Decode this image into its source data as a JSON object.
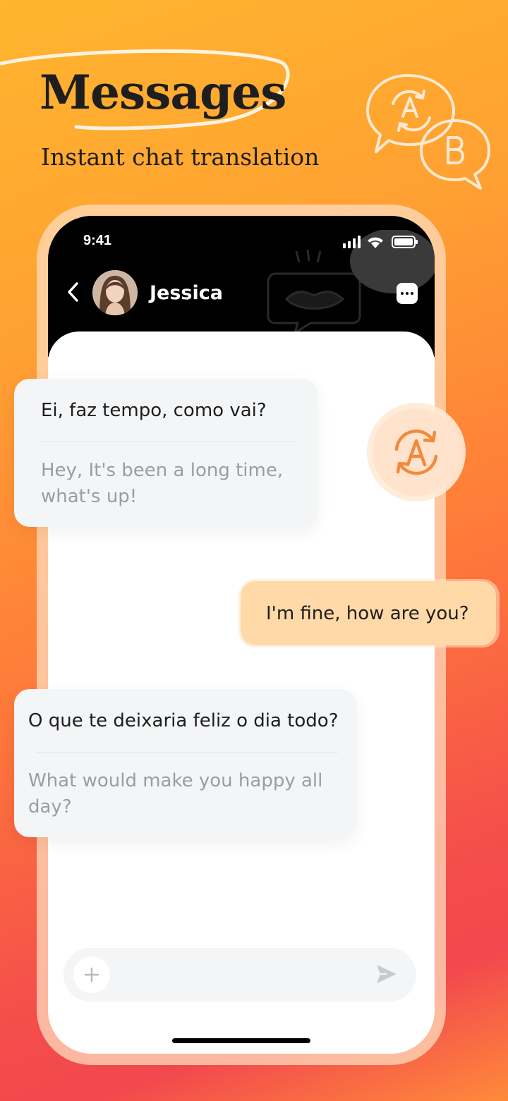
{
  "promo": {
    "headline": "Messages",
    "subheadline": "Instant chat translation"
  },
  "status_bar": {
    "time": "9:41"
  },
  "chat_header": {
    "contact_name": "Jessica"
  },
  "messages": [
    {
      "from": "contact",
      "original": "Ei, faz tempo, como vai?",
      "translation": "Hey, It's been a long time, what's up!"
    },
    {
      "from": "me",
      "original": "I'm fine, how are you?"
    },
    {
      "from": "contact",
      "original": "O que te deixaria feliz o dia todo?",
      "translation": "What would make you happy all day?"
    }
  ],
  "colors": {
    "my_bubble": "#ffd9a8",
    "contact_bubble": "#f4f5f7",
    "accent": "#f28a3c",
    "header_bg": "#000000"
  },
  "icons": {
    "translate": "translate-ab-icon",
    "send": "send-icon",
    "add": "plus-icon",
    "more": "more-dots-icon",
    "back": "chevron-left-icon"
  }
}
